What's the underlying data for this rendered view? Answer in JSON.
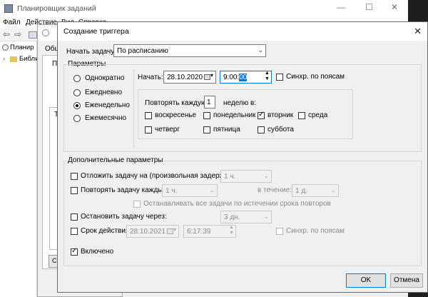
{
  "bg": {
    "title": "Планировщик заданий",
    "ctl_min": "—",
    "ctl_max": "☐",
    "ctl_close": "✕",
    "menu": [
      "Файл",
      "Действие",
      "Вид",
      "Справка"
    ],
    "tree_item1": "Планир",
    "tree_item2": "Библи",
    "dialog2_tab1": "Общ",
    "dialog2_label": "Пр",
    "dialog2_list": "Тр",
    "dialog2_btn": "С"
  },
  "dialog": {
    "title": "Создание триггера",
    "close": "✕",
    "start_task_label": "Начать задачу:",
    "start_task_value": "По расписанию",
    "params_label": "Параметры",
    "radios": [
      "Однократно",
      "Ежедневно",
      "Еженедельно",
      "Ежемесячно"
    ],
    "selected_radio": "Еженедельно",
    "start_label": "Начать:",
    "start_date": "28.10.2020",
    "start_time": "9:00:",
    "start_time_sel": "00",
    "sync_label": "Синхр. по поясам",
    "repeat_every_label": "Повторять каждую",
    "repeat_every_value": "1",
    "weeks_label": "неделю в:",
    "days": {
      "mon": "понедельник",
      "tue": "вторник",
      "wed": "среда",
      "thu": "четверг",
      "fri": "пятница",
      "sat": "суббота",
      "sun": "воскресенье"
    },
    "checked_day": "вторник",
    "extra_label": "Дополнительные параметры",
    "delay_label": "Отложить задачу на (произвольная задержка):",
    "delay_value": "1 ч.",
    "repeat_label": "Повторять задачу каждые:",
    "repeat_value": "1 ч.",
    "during_label": "в течение:",
    "during_value": "1 д.",
    "stop_all_label": "Останавливать все задачи по истечении срока повторов",
    "stop_after_label": "Остановить задачу через:",
    "stop_after_value": "3 дн.",
    "expire_label": "Срок действия:",
    "expire_date": "28.10.2021",
    "expire_time": "6:17:39",
    "expire_sync_label": "Синхр. по поясам",
    "enabled_label": "Включено",
    "ok": "OK",
    "cancel": "Отмена"
  }
}
